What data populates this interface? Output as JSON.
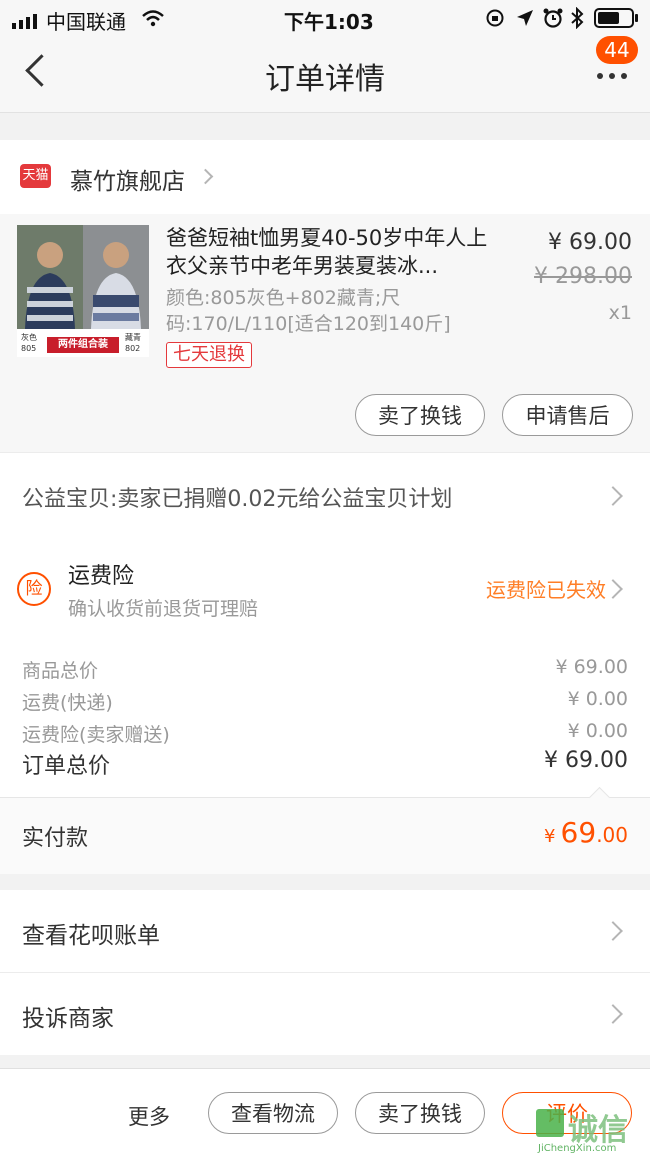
{
  "status_bar": {
    "carrier": "中国联通",
    "time": "下午1:03"
  },
  "nav": {
    "title": "订单详情",
    "badge_count": "44"
  },
  "store": {
    "platform_label": "天猫",
    "name": "慕竹旗舰店"
  },
  "product": {
    "title": "爸爸短袖t恤男夏40-50岁中年人上衣父亲节中老年男装夏装冰...",
    "spec": "颜色:805灰色+802藏青;尺码:170/L/110[适合120到140斤]",
    "tag": "七天退换",
    "price": "¥ 69.00",
    "original_price": "¥ 298.00",
    "quantity": "x1",
    "image_left_color": "灰色",
    "image_left_code": "805",
    "image_center_label": "两件组合装",
    "image_right_color": "藏青",
    "image_right_code": "802"
  },
  "item_actions": {
    "sell_exchange": "卖了换钱",
    "after_sale": "申请售后"
  },
  "charity": {
    "text": "公益宝贝:卖家已捐赠0.02元给公益宝贝计划"
  },
  "insurance": {
    "icon_text": "险",
    "title": "运费险",
    "subtitle": "确认收货前退货可理赔",
    "status": "运费险已失效"
  },
  "summary": {
    "goods_total_label": "商品总价",
    "goods_total_value": "¥ 69.00",
    "shipping_label": "运费(快递)",
    "shipping_value": "¥ 0.00",
    "insurance_fee_label": "运费险(卖家赠送)",
    "insurance_fee_value": "¥ 0.00",
    "order_total_label": "订单总价",
    "order_total_value": "¥ 69.00"
  },
  "payment": {
    "label": "实付款",
    "currency": "¥",
    "amount_int": "69",
    "amount_dec": ".00"
  },
  "links": {
    "huabei": "查看花呗账单",
    "complaint": "投诉商家"
  },
  "bottom_bar": {
    "more": "更多",
    "logistics": "查看物流",
    "sell_exchange": "卖了换钱",
    "review": "评价"
  },
  "watermark": {
    "text": "诚信",
    "url": "JiChengXin.com"
  },
  "colors": {
    "accent_orange": "#ff5000",
    "tmall_red": "#e4393c",
    "background": "#f2f2f2"
  }
}
